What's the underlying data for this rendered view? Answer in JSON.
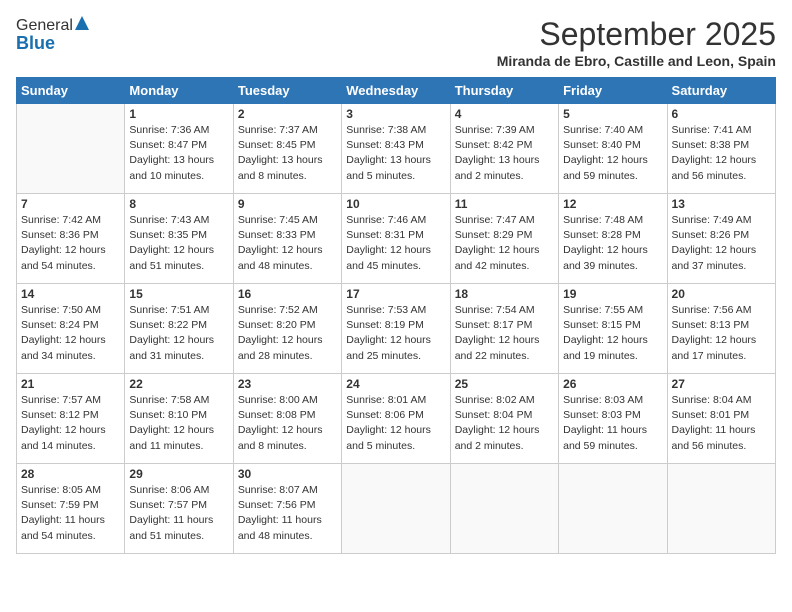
{
  "header": {
    "logo_general": "General",
    "logo_blue": "Blue",
    "month_title": "September 2025",
    "location": "Miranda de Ebro, Castille and Leon, Spain"
  },
  "weekdays": [
    "Sunday",
    "Monday",
    "Tuesday",
    "Wednesday",
    "Thursday",
    "Friday",
    "Saturday"
  ],
  "weeks": [
    [
      {
        "day": "",
        "info": ""
      },
      {
        "day": "1",
        "info": "Sunrise: 7:36 AM\nSunset: 8:47 PM\nDaylight: 13 hours\nand 10 minutes."
      },
      {
        "day": "2",
        "info": "Sunrise: 7:37 AM\nSunset: 8:45 PM\nDaylight: 13 hours\nand 8 minutes."
      },
      {
        "day": "3",
        "info": "Sunrise: 7:38 AM\nSunset: 8:43 PM\nDaylight: 13 hours\nand 5 minutes."
      },
      {
        "day": "4",
        "info": "Sunrise: 7:39 AM\nSunset: 8:42 PM\nDaylight: 13 hours\nand 2 minutes."
      },
      {
        "day": "5",
        "info": "Sunrise: 7:40 AM\nSunset: 8:40 PM\nDaylight: 12 hours\nand 59 minutes."
      },
      {
        "day": "6",
        "info": "Sunrise: 7:41 AM\nSunset: 8:38 PM\nDaylight: 12 hours\nand 56 minutes."
      }
    ],
    [
      {
        "day": "7",
        "info": "Sunrise: 7:42 AM\nSunset: 8:36 PM\nDaylight: 12 hours\nand 54 minutes."
      },
      {
        "day": "8",
        "info": "Sunrise: 7:43 AM\nSunset: 8:35 PM\nDaylight: 12 hours\nand 51 minutes."
      },
      {
        "day": "9",
        "info": "Sunrise: 7:45 AM\nSunset: 8:33 PM\nDaylight: 12 hours\nand 48 minutes."
      },
      {
        "day": "10",
        "info": "Sunrise: 7:46 AM\nSunset: 8:31 PM\nDaylight: 12 hours\nand 45 minutes."
      },
      {
        "day": "11",
        "info": "Sunrise: 7:47 AM\nSunset: 8:29 PM\nDaylight: 12 hours\nand 42 minutes."
      },
      {
        "day": "12",
        "info": "Sunrise: 7:48 AM\nSunset: 8:28 PM\nDaylight: 12 hours\nand 39 minutes."
      },
      {
        "day": "13",
        "info": "Sunrise: 7:49 AM\nSunset: 8:26 PM\nDaylight: 12 hours\nand 37 minutes."
      }
    ],
    [
      {
        "day": "14",
        "info": "Sunrise: 7:50 AM\nSunset: 8:24 PM\nDaylight: 12 hours\nand 34 minutes."
      },
      {
        "day": "15",
        "info": "Sunrise: 7:51 AM\nSunset: 8:22 PM\nDaylight: 12 hours\nand 31 minutes."
      },
      {
        "day": "16",
        "info": "Sunrise: 7:52 AM\nSunset: 8:20 PM\nDaylight: 12 hours\nand 28 minutes."
      },
      {
        "day": "17",
        "info": "Sunrise: 7:53 AM\nSunset: 8:19 PM\nDaylight: 12 hours\nand 25 minutes."
      },
      {
        "day": "18",
        "info": "Sunrise: 7:54 AM\nSunset: 8:17 PM\nDaylight: 12 hours\nand 22 minutes."
      },
      {
        "day": "19",
        "info": "Sunrise: 7:55 AM\nSunset: 8:15 PM\nDaylight: 12 hours\nand 19 minutes."
      },
      {
        "day": "20",
        "info": "Sunrise: 7:56 AM\nSunset: 8:13 PM\nDaylight: 12 hours\nand 17 minutes."
      }
    ],
    [
      {
        "day": "21",
        "info": "Sunrise: 7:57 AM\nSunset: 8:12 PM\nDaylight: 12 hours\nand 14 minutes."
      },
      {
        "day": "22",
        "info": "Sunrise: 7:58 AM\nSunset: 8:10 PM\nDaylight: 12 hours\nand 11 minutes."
      },
      {
        "day": "23",
        "info": "Sunrise: 8:00 AM\nSunset: 8:08 PM\nDaylight: 12 hours\nand 8 minutes."
      },
      {
        "day": "24",
        "info": "Sunrise: 8:01 AM\nSunset: 8:06 PM\nDaylight: 12 hours\nand 5 minutes."
      },
      {
        "day": "25",
        "info": "Sunrise: 8:02 AM\nSunset: 8:04 PM\nDaylight: 12 hours\nand 2 minutes."
      },
      {
        "day": "26",
        "info": "Sunrise: 8:03 AM\nSunset: 8:03 PM\nDaylight: 11 hours\nand 59 minutes."
      },
      {
        "day": "27",
        "info": "Sunrise: 8:04 AM\nSunset: 8:01 PM\nDaylight: 11 hours\nand 56 minutes."
      }
    ],
    [
      {
        "day": "28",
        "info": "Sunrise: 8:05 AM\nSunset: 7:59 PM\nDaylight: 11 hours\nand 54 minutes."
      },
      {
        "day": "29",
        "info": "Sunrise: 8:06 AM\nSunset: 7:57 PM\nDaylight: 11 hours\nand 51 minutes."
      },
      {
        "day": "30",
        "info": "Sunrise: 8:07 AM\nSunset: 7:56 PM\nDaylight: 11 hours\nand 48 minutes."
      },
      {
        "day": "",
        "info": ""
      },
      {
        "day": "",
        "info": ""
      },
      {
        "day": "",
        "info": ""
      },
      {
        "day": "",
        "info": ""
      }
    ]
  ]
}
